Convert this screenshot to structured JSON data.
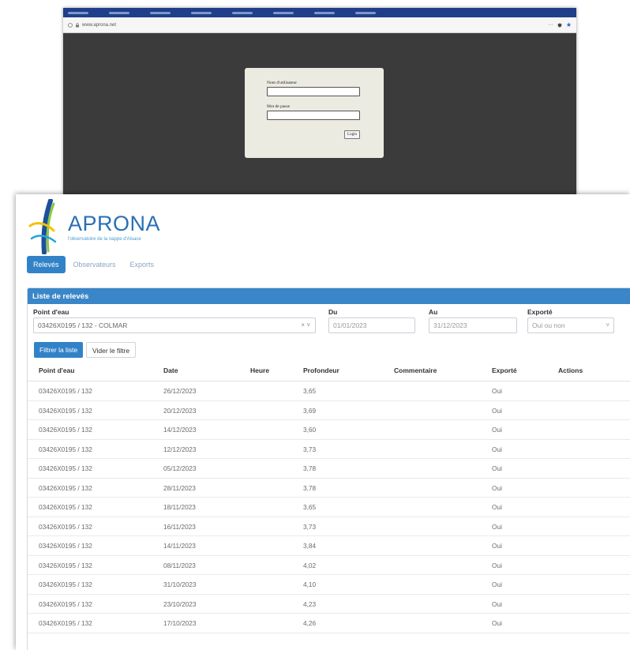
{
  "browser": {
    "url": "www.aprona.net",
    "menu_dots": "···"
  },
  "login": {
    "username_label": "Nom d'utilisateur",
    "password_label": "Mot de passe",
    "button_label": "Login"
  },
  "app": {
    "logo_name": "APRONA",
    "logo_tagline": "l'observatoire de la nappe d'Alsace",
    "tabs": [
      {
        "label": "Relevés",
        "active": true
      },
      {
        "label": "Observateurs",
        "active": false
      },
      {
        "label": "Exports",
        "active": false
      }
    ],
    "panel_title": "Liste de relevés",
    "filters": {
      "point_label": "Point d'eau",
      "point_value": "03426X0195 / 132 - COLMAR",
      "point_controls": "× ˅",
      "du_label": "Du",
      "du_value": "01/01/2023",
      "au_label": "Au",
      "au_value": "31/12/2023",
      "exporte_label": "Exporté",
      "exporte_value": "Oui ou non",
      "filter_button": "Filtrer la liste",
      "clear_button": "Vider le filtre"
    },
    "table": {
      "headers": [
        "Point d'eau",
        "Date",
        "Heure",
        "Profondeur",
        "Commentaire",
        "Exporté",
        "Actions"
      ],
      "rows": [
        [
          "03426X0195 / 132",
          "26/12/2023",
          "",
          "3,65",
          "",
          "Oui",
          ""
        ],
        [
          "03426X0195 / 132",
          "20/12/2023",
          "",
          "3,69",
          "",
          "Oui",
          ""
        ],
        [
          "03426X0195 / 132",
          "14/12/2023",
          "",
          "3,60",
          "",
          "Oui",
          ""
        ],
        [
          "03426X0195 / 132",
          "12/12/2023",
          "",
          "3,73",
          "",
          "Oui",
          ""
        ],
        [
          "03426X0195 / 132",
          "05/12/2023",
          "",
          "3,78",
          "",
          "Oui",
          ""
        ],
        [
          "03426X0195 / 132",
          "28/11/2023",
          "",
          "3,78",
          "",
          "Oui",
          ""
        ],
        [
          "03426X0195 / 132",
          "18/11/2023",
          "",
          "3,65",
          "",
          "Oui",
          ""
        ],
        [
          "03426X0195 / 132",
          "16/11/2023",
          "",
          "3,73",
          "",
          "Oui",
          ""
        ],
        [
          "03426X0195 / 132",
          "14/11/2023",
          "",
          "3,84",
          "",
          "Oui",
          ""
        ],
        [
          "03426X0195 / 132",
          "08/11/2023",
          "",
          "4,02",
          "",
          "Oui",
          ""
        ],
        [
          "03426X0195 / 132",
          "31/10/2023",
          "",
          "4,10",
          "",
          "Oui",
          ""
        ],
        [
          "03426X0195 / 132",
          "23/10/2023",
          "",
          "4,23",
          "",
          "Oui",
          ""
        ],
        [
          "03426X0195 / 132",
          "17/10/2023",
          "",
          "4,26",
          "",
          "Oui",
          ""
        ]
      ]
    }
  }
}
